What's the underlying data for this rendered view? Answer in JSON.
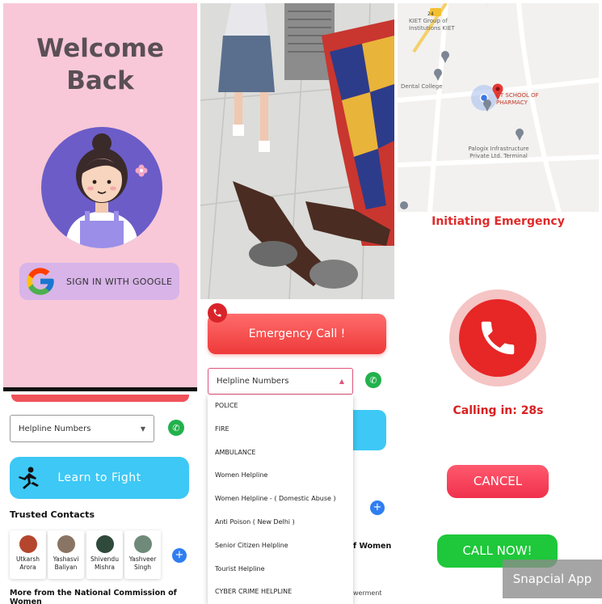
{
  "welcome_screen": {
    "title_line1": "Welcome",
    "title_line2": "Back",
    "google_button_label": "SIGN IN WITH GOOGLE"
  },
  "home_screen": {
    "helpline_select_value": "Helpline Numbers",
    "learn_to_fight_label": "Learn to Fight",
    "trusted_contacts_title": "Trusted Contacts",
    "contacts": [
      {
        "name": "Utkarsh Arora"
      },
      {
        "name": "Yashasvi Baliyan"
      },
      {
        "name": "Shivendu Mishra"
      },
      {
        "name": "Yashveer Singh"
      }
    ],
    "ncw_title": "More from the National Commission of Women"
  },
  "emergency_screen": {
    "emergency_call_label": "Emergency Call !",
    "helpline_select_value": "Helpline Numbers",
    "dropdown_options": [
      "POLICE",
      "FIRE",
      "AMBULANCE",
      "Women Helpline",
      "Women Helpline - ( Domestic Abuse )",
      "Anti Poison ( New Delhi )",
      "Senior Citizen Helpline",
      "Tourist Helpline",
      "CYBER CRIME HELPLINE"
    ],
    "peek_women_text": "f Women",
    "peek_empowerment_text": "werment"
  },
  "calling_screen": {
    "map_labels": {
      "kiet": "KIET Group of Institutions KIET",
      "dental": "Dental College",
      "school": "CT SCHOOL OF PHARMACY",
      "palogix": "Palogix Infrastructure Private Ltd. Terminal",
      "road_number": "24"
    },
    "initiating_text": "Initiating Emergency",
    "calling_text": "Calling in: 28s",
    "cancel_label": "CANCEL",
    "call_now_label": "CALL NOW!"
  },
  "watermark": "Snapcial App",
  "colors": {
    "pink_bg": "#f8c8d8",
    "emergency_red": "#e72626",
    "sky_blue": "#3dc8f5",
    "call_green": "#1ec83a"
  }
}
